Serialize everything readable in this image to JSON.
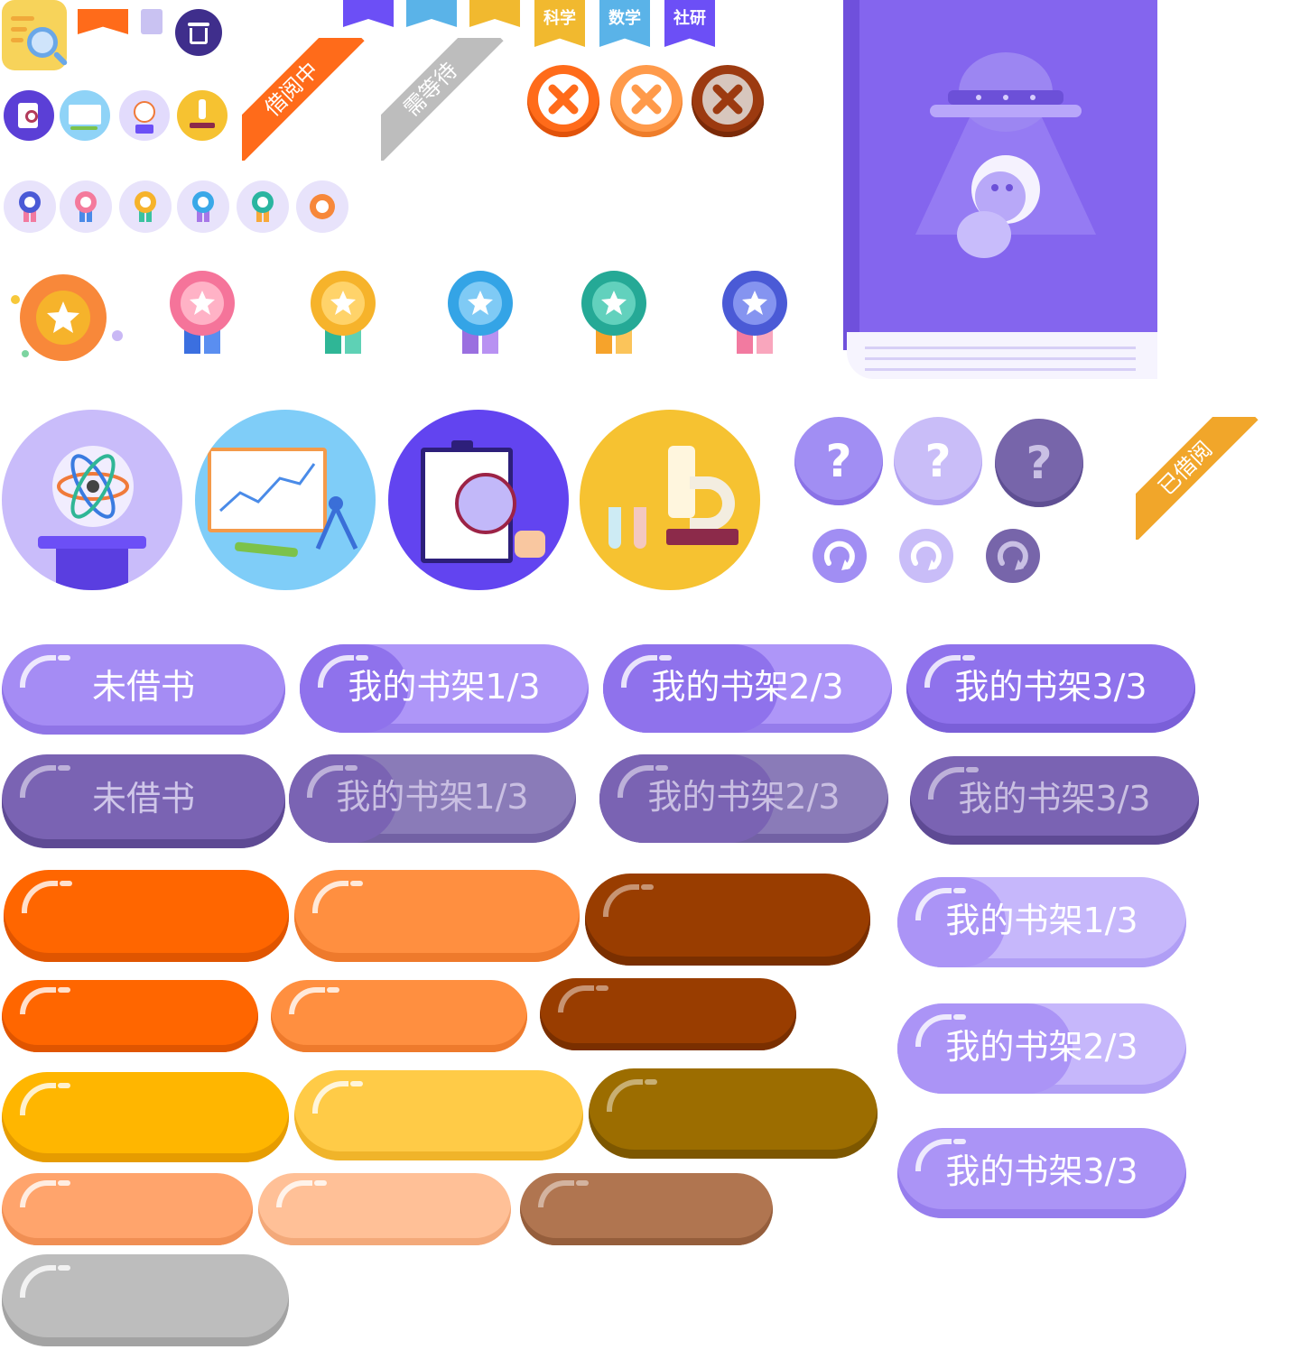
{
  "ribbons": {
    "borrowing": "借阅中",
    "waiting": "需等待",
    "borrowed": "已借阅"
  },
  "subject_tags": [
    "科学",
    "数学",
    "社研"
  ],
  "buttons": {
    "not_borrowed": "未借书",
    "shelf_1": "我的书架1/3",
    "shelf_2": "我的书架2/3",
    "shelf_3": "我的书架3/3"
  },
  "help_symbol": "?",
  "colors": {
    "purple_light": "#a58cf4",
    "purple_dark": "#7a63b3",
    "orange": "#ff6600",
    "orange_light": "#ff8f40",
    "brown": "#993d00",
    "yellow": "#ffb600",
    "yellow_light": "#ffcb47",
    "gold_brown": "#9c6d00",
    "peach": "#ffa46c",
    "peach_light": "#ffc097",
    "tan": "#b07550",
    "gray": "#bdbdbd",
    "book_purple": "#8465ee"
  }
}
